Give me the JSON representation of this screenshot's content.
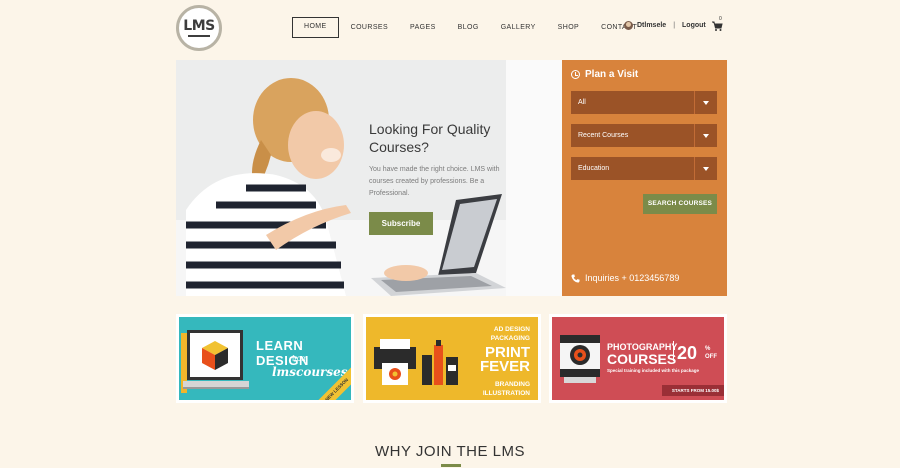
{
  "logo": {
    "text": "LMS"
  },
  "nav": {
    "items": [
      {
        "label": "HOME",
        "active": true
      },
      {
        "label": "COURSES"
      },
      {
        "label": "PAGES"
      },
      {
        "label": "BLOG"
      },
      {
        "label": "GALLERY"
      },
      {
        "label": "SHOP"
      },
      {
        "label": "CONTACT"
      }
    ]
  },
  "user": {
    "name": "Dtlmsele",
    "logout": "Logout",
    "cart_count": "0",
    "icons": [
      "avatar",
      "cart-icon"
    ]
  },
  "hero": {
    "title": "Looking For Quality Courses?",
    "description": "You have made the right choice. LMS with courses created by professions. Be a Professional.",
    "subscribe_label": "Subscribe"
  },
  "visit": {
    "title": "Plan a Visit",
    "selects": [
      "All",
      "Recent Courses",
      "Education"
    ],
    "search_label": "SEARCH COURSES",
    "inquiries": "Inquiries + 0123456789",
    "colors": {
      "panel": "#d8833c",
      "select": "#9b5327",
      "button": "#7b8b49"
    }
  },
  "banners": {
    "design": {
      "line1": "LEARN DESIGN",
      "line2": "from",
      "line3": "lmscourses",
      "ribbon": "NEW LESSON"
    },
    "print": {
      "line1": "AD DESIGN",
      "line2": "PACKAGING",
      "line3": "PRINT",
      "line4": "FEVER",
      "line5": "BRANDING",
      "line6": "ILLUSTRATION"
    },
    "photo": {
      "line1": "PHOTOGRAPHY",
      "line2": "COURSES",
      "percent": "20",
      "pct_sign": "%",
      "off": "OFF",
      "note": "Special training included with this package",
      "price": "STARTS FROM 15.00$"
    }
  },
  "why": {
    "title": "WHY JOIN THE LMS"
  }
}
